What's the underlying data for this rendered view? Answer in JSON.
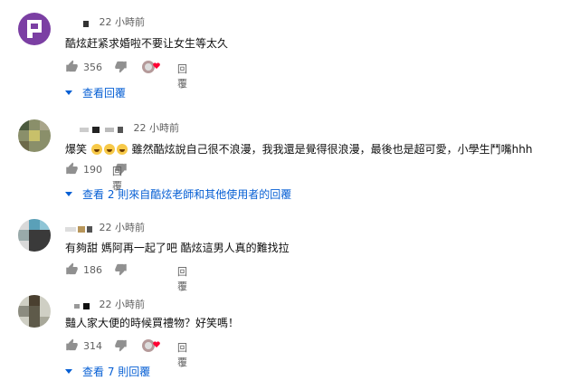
{
  "comments": [
    {
      "time": "22 小時前",
      "text": "酷炫赶紧求婚啦不要让女生等太久",
      "likes": "356",
      "reply_label": "回覆",
      "view_replies": "查看回覆"
    },
    {
      "time": "22 小時前",
      "text_prefix": "爆笑",
      "text": "雖然酷炫說自己很不浪漫，我我還是覺得很浪漫，最後也是超可愛，小學生鬥嘴hhh",
      "likes": "190",
      "reply_label": "回覆",
      "view_replies": "查看 2 則來自酷炫老師和其他使用者的回覆"
    },
    {
      "time": "22 小時前",
      "text": "有夠甜 媽阿再一起了吧 酷炫這男人真的難找拉",
      "likes": "186",
      "reply_label": "回覆"
    },
    {
      "time": "22 小時前",
      "text": "豔人家大便的時候買禮物？好笑嗎！",
      "likes": "314",
      "reply_label": "回覆",
      "view_replies": "查看 7 則回覆"
    }
  ],
  "icons": {
    "like": "thumb-up-icon",
    "dislike": "thumb-down-icon",
    "hearted": "creator-heart-icon",
    "expand": "caret-down-icon",
    "emoji": "laughing-face-emoji"
  },
  "colors": {
    "link": "#065fd4",
    "secondary": "#606060",
    "heart": "#ff0033",
    "avatar1": "#7b3fa3"
  }
}
